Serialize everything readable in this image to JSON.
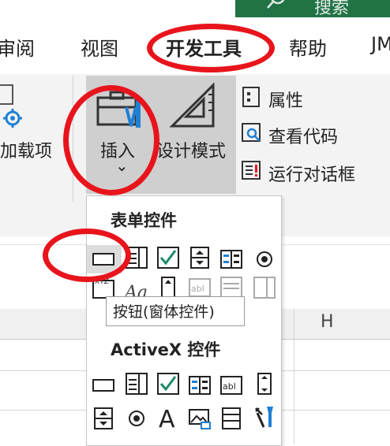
{
  "titlebar": {
    "search_text": "搜索"
  },
  "tabs": [
    {
      "label": "审阅"
    },
    {
      "label": "视图"
    },
    {
      "label": "开发工具"
    },
    {
      "label": "帮助"
    },
    {
      "label": "JM"
    }
  ],
  "ribbon": {
    "addins_label": "加载项",
    "insert_label": "插入",
    "insert_chevron": "⌄",
    "design_mode_label": "设计模式",
    "properties_label": "属性",
    "view_code_label": "查看代码",
    "run_dialog_label": "运行对话框"
  },
  "dropdown": {
    "form_controls_title": "表单控件",
    "activex_title": "ActiveX 控件",
    "tooltip": "按钮(窗体控件)"
  },
  "sheet": {
    "column_h": "H"
  },
  "colors": {
    "accent_green": "#217346",
    "annotation_red": "#e8141c",
    "checkbox_teal": "#1a8a6a"
  }
}
